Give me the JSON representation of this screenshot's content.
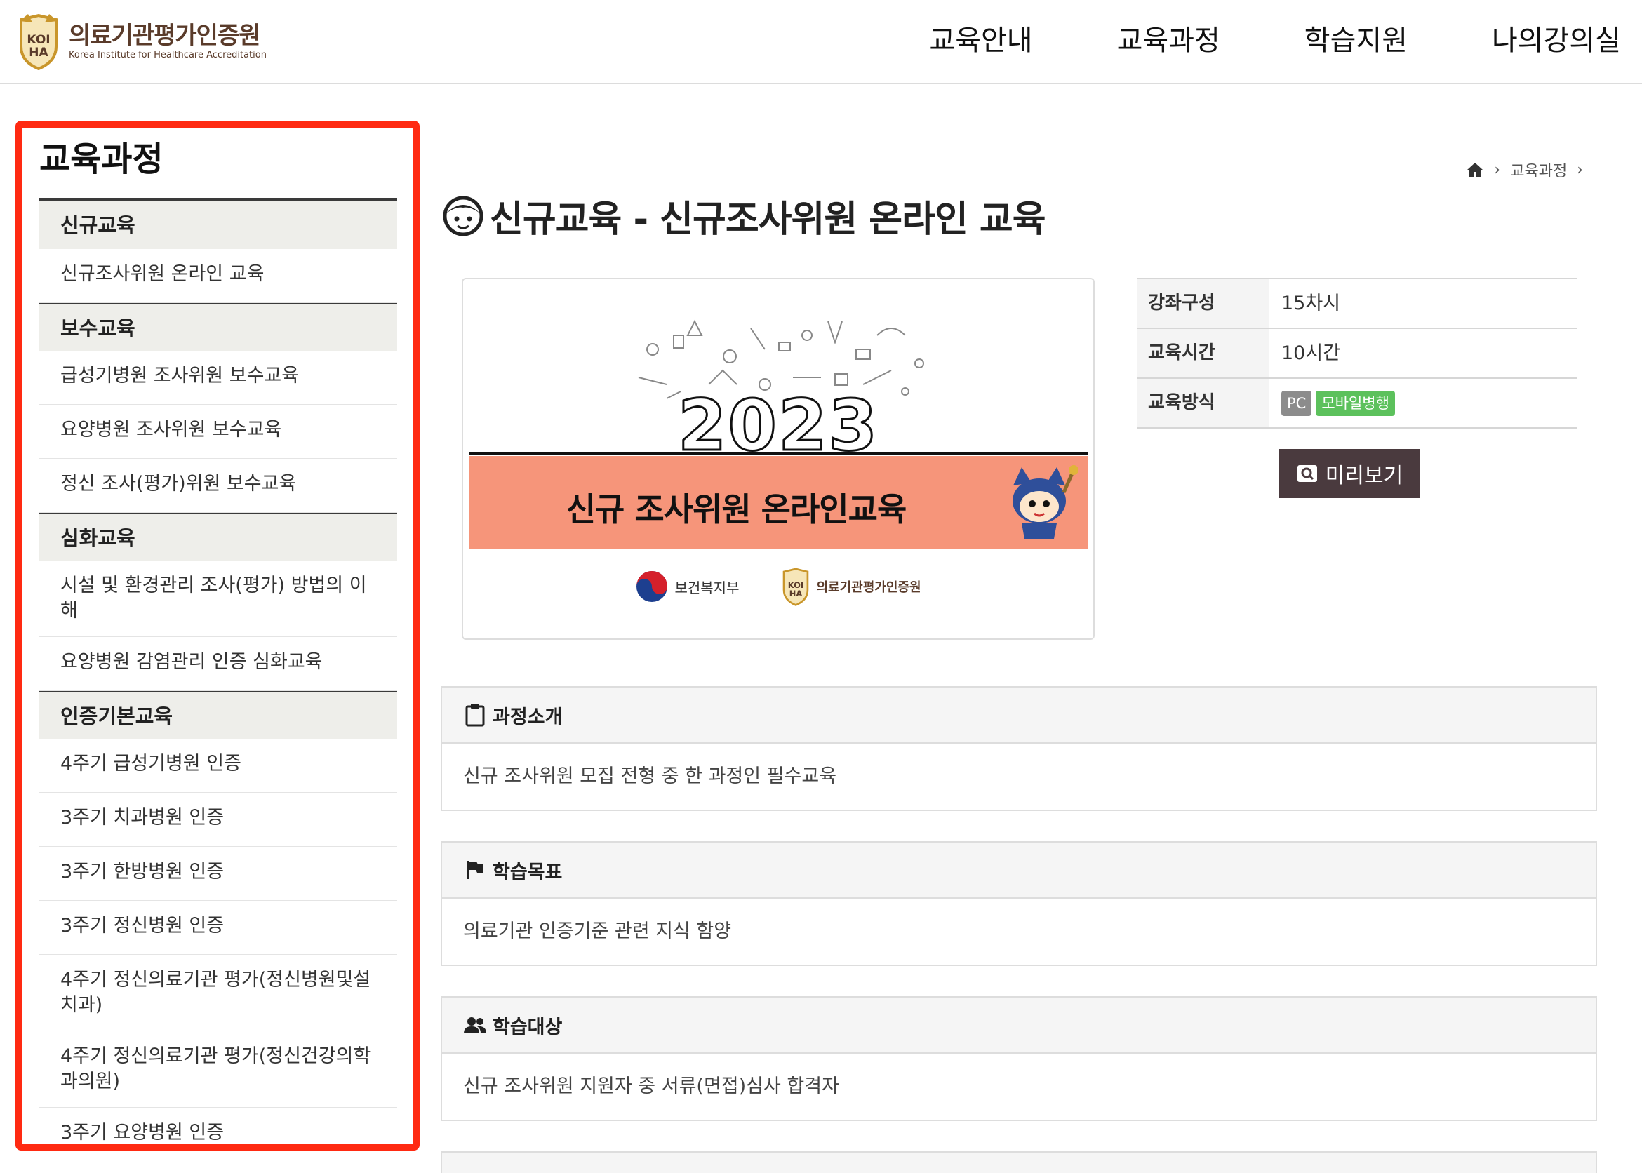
{
  "header": {
    "logo_kr": "의료기관평가인증원",
    "logo_en": "Korea Institute for Healthcare Accreditation",
    "logo_badge": "KOIHA",
    "nav": [
      "교육안내",
      "교육과정",
      "학습지원",
      "나의강의실"
    ]
  },
  "sidebar": {
    "title": "교육과정",
    "categories": [
      {
        "label": "신규교육",
        "items": [
          "신규조사위원 온라인 교육"
        ]
      },
      {
        "label": "보수교육",
        "items": [
          "급성기병원 조사위원 보수교육",
          "요양병원 조사위원 보수교육",
          "정신 조사(평가)위원 보수교육"
        ]
      },
      {
        "label": "심화교육",
        "items": [
          "시설 및 환경관리 조사(평가) 방법의 이해",
          "요양병원 감염관리 인증 심화교육"
        ]
      },
      {
        "label": "인증기본교육",
        "items": [
          "4주기 급성기병원 인증",
          "3주기 치과병원 인증",
          "3주기 한방병원 인증",
          "3주기 정신병원 인증",
          "4주기 정신의료기관 평가(정신병원및설치과)",
          "4주기 정신의료기관 평가(정신건강의학과의원)",
          "3주기 요양병원 인증"
        ]
      }
    ]
  },
  "breadcrumb": {
    "current": "교육과정"
  },
  "page": {
    "title": "신규교육 - 신규조사위원 온라인 교육"
  },
  "thumbnail": {
    "year": "2023",
    "banner": "신규 조사위원 온라인교육",
    "logo1": "보건복지부",
    "logo2": "의료기관평가인증원",
    "logo2_badge": "KOIHA"
  },
  "info": {
    "rows": [
      {
        "label": "강좌구성",
        "value": "15차시"
      },
      {
        "label": "교육시간",
        "value": "10시간"
      },
      {
        "label": "교육방식",
        "badges": [
          "PC",
          "모바일병행"
        ]
      }
    ],
    "preview_label": "미리보기"
  },
  "sections": [
    {
      "label": "과정소개",
      "body": "신규 조사위원 모집 전형 중 한 과정인 필수교육"
    },
    {
      "label": "학습목표",
      "body": "의료기관 인증기준 관련 지식 함양"
    },
    {
      "label": "학습대상",
      "body": "신규 조사위원 지원자 중 서류(면접)심사 합격자"
    }
  ],
  "colors": {
    "highlight_border": "#ff2a12",
    "banner": "#f6957a",
    "preview_button": "#4a3a3e",
    "badge_mobile": "#5cc15c",
    "badge_pc": "#8c8c8c"
  }
}
